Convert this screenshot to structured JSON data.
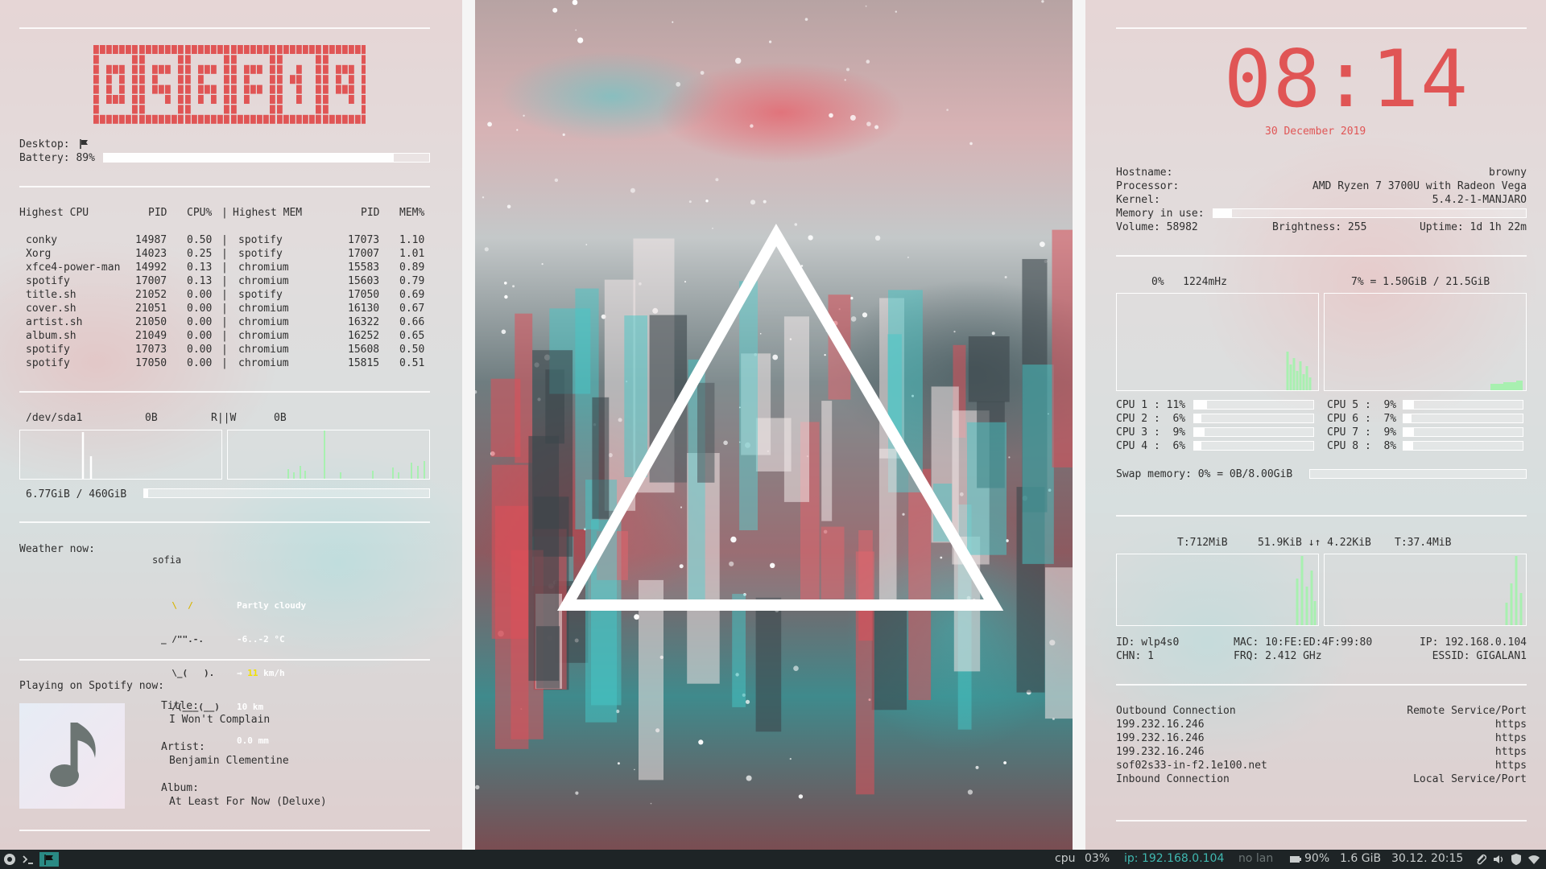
{
  "colors": {
    "accent_red": "#e05555",
    "graph_green": "#a8f0b0",
    "taskbar_bg": "#1e2426",
    "taskbar_ip": "#3fb8b0"
  },
  "left": {
    "digital_logo": "M▯N▯M▯J",
    "desktop_label": "Desktop:",
    "desktop_icon": "flag-icon",
    "battery_label": "Battery: 89%",
    "battery_fraction": 0.89,
    "proc_header": {
      "highest_cpu": "Highest CPU",
      "pid": "PID",
      "cpu_pct": "CPU%",
      "sep": "|",
      "highest_mem": "Highest MEM",
      "pid2": "PID",
      "mem_pct": "MEM%"
    },
    "proc_rows": [
      {
        "cpu_name": "conky",
        "cpu_pid": "14987",
        "cpu_pct": "0.50",
        "mem_name": "spotify",
        "mem_pid": "17073",
        "mem_pct": "1.10"
      },
      {
        "cpu_name": "Xorg",
        "cpu_pid": "14023",
        "cpu_pct": "0.25",
        "mem_name": "spotify",
        "mem_pid": "17007",
        "mem_pct": "1.01"
      },
      {
        "cpu_name": "xfce4-power-man",
        "cpu_pid": "14992",
        "cpu_pct": "0.13",
        "mem_name": "chromium",
        "mem_pid": "15583",
        "mem_pct": "0.89"
      },
      {
        "cpu_name": "spotify",
        "cpu_pid": "17007",
        "cpu_pct": "0.13",
        "mem_name": "chromium",
        "mem_pid": "15603",
        "mem_pct": "0.79"
      },
      {
        "cpu_name": "title.sh",
        "cpu_pid": "21052",
        "cpu_pct": "0.00",
        "mem_name": "spotify",
        "mem_pid": "17050",
        "mem_pct": "0.69"
      },
      {
        "cpu_name": "cover.sh",
        "cpu_pid": "21051",
        "cpu_pct": "0.00",
        "mem_name": "chromium",
        "mem_pid": "16130",
        "mem_pct": "0.67"
      },
      {
        "cpu_name": "artist.sh",
        "cpu_pid": "21050",
        "cpu_pct": "0.00",
        "mem_name": "chromium",
        "mem_pid": "16322",
        "mem_pct": "0.66"
      },
      {
        "cpu_name": "album.sh",
        "cpu_pid": "21049",
        "cpu_pct": "0.00",
        "mem_name": "chromium",
        "mem_pid": "16252",
        "mem_pct": "0.65"
      },
      {
        "cpu_name": "spotify",
        "cpu_pid": "17073",
        "cpu_pct": "0.00",
        "mem_name": "chromium",
        "mem_pid": "15608",
        "mem_pct": "0.50"
      },
      {
        "cpu_name": "spotify",
        "cpu_pid": "17050",
        "cpu_pct": "0.00",
        "mem_name": "chromium",
        "mem_pid": "15815",
        "mem_pct": "0.51"
      }
    ],
    "disk": {
      "device": "/dev/sda1",
      "read": "0B",
      "rw_label": "R||W",
      "write": "0B",
      "usage": "6.77GiB / 460GiB",
      "usage_fraction": 0.015
    },
    "weather": {
      "label": "Weather now:",
      "city": "sofia",
      "art": [
        "  \\  /",
        "_ /\"\".-.",
        "  \\_(   ).",
        "  /(___(__)"
      ],
      "condition": "Partly cloudy",
      "temp": "-6..-2 °C",
      "wind_arrow": "→",
      "wind_speed": "11",
      "wind_unit": "km/h",
      "visibility": "10 km",
      "precip": "0.0 mm"
    },
    "spotify": {
      "label": "Playing on Spotify now:",
      "cover_icon": "music-note-icon",
      "title_label": "Title:",
      "title": "I Won't Complain",
      "artist_label": "Artist:",
      "artist": "Benjamin Clementine",
      "album_label": "Album:",
      "album": "At Least For Now (Deluxe)"
    }
  },
  "right": {
    "clock": "08:14",
    "date": "30 December 2019",
    "hostname_label": "Hostname:",
    "hostname": "browny",
    "processor_label": "Processor:",
    "processor": "AMD Ryzen 7 3700U with Radeon Vega",
    "kernel_label": "Kernel:",
    "kernel": "5.4.2-1-MANJARO",
    "memory_label": "Memory in use:",
    "memory_fraction": 0.06,
    "volume": "Volume: 58982",
    "brightness": "Brightness: 255",
    "uptime": "Uptime: 1d 1h 22m",
    "cpu_summary": "0%   1224mHz",
    "mem_summary": "7% = 1.50GiB / 21.5GiB",
    "cpus": [
      {
        "label": "CPU 1 : 11%",
        "fraction": 0.11
      },
      {
        "label": "CPU 5 :  9%",
        "fraction": 0.09
      },
      {
        "label": "CPU 2 :  6%",
        "fraction": 0.06
      },
      {
        "label": "CPU 6 :  7%",
        "fraction": 0.07
      },
      {
        "label": "CPU 3 :  9%",
        "fraction": 0.09
      },
      {
        "label": "CPU 7 :  9%",
        "fraction": 0.09
      },
      {
        "label": "CPU 4 :  6%",
        "fraction": 0.06
      },
      {
        "label": "CPU 8 :  8%",
        "fraction": 0.08
      }
    ],
    "swap": "Swap memory: 0% = 0B/8.00GiB",
    "swap_fraction": 0.0,
    "net_total_down": "T:712MiB",
    "net_rates": "51.9KiB ↓↑ 4.22KiB",
    "net_total_up": "T:37.4MiB",
    "net_id": "ID: wlp4s0",
    "net_mac": "MAC: 10:FE:ED:4F:99:80",
    "net_ip": "IP: 192.168.0.104",
    "net_chn": "CHN: 1",
    "net_frq": "FRQ: 2.412 GHz",
    "net_essid": "ESSID: GIGALAN1",
    "conn_out_label": "Outbound Connection",
    "conn_remote_label": "Remote Service/Port",
    "connections": [
      {
        "host": "199.232.16.246",
        "port": "https"
      },
      {
        "host": "199.232.16.246",
        "port": "https"
      },
      {
        "host": "199.232.16.246",
        "port": "https"
      },
      {
        "host": "sof02s33-in-f2.1e100.net",
        "port": "https"
      }
    ],
    "conn_in_label": "Inbound Connection",
    "conn_local_label": "Local Service/Port"
  },
  "taskbar": {
    "start_icon": "menu-logo-icon",
    "terminal_icon": "terminal-icon",
    "workspace_icon": "flag-icon",
    "cpu_label": "cpu",
    "cpu_value": "03%",
    "ip": "ip: 192.168.0.104",
    "lan": "no lan",
    "battery_icon": "battery-icon",
    "battery": "90%",
    "memory": "1.6 GiB",
    "datetime": "30.12. 20:15",
    "tray_icons": [
      "paperclip-icon",
      "speaker-icon",
      "shield-icon",
      "wifi-icon"
    ]
  }
}
